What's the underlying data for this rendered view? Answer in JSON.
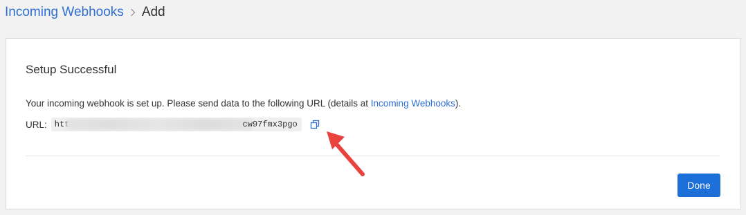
{
  "breadcrumb": {
    "parent": "Incoming Webhooks",
    "current": "Add"
  },
  "panel": {
    "title": "Setup Successful",
    "message_prefix": "Your incoming webhook is set up. Please send data to the following URL (details at ",
    "message_link": "Incoming Webhooks",
    "message_suffix": ").",
    "url_label": "URL:",
    "url_visible_start": "htt",
    "url_visible_end": "cw97fmx3pgo",
    "done_label": "Done"
  },
  "icons": {
    "separator": "chevron-right-icon",
    "copy": "copy-icon",
    "annotation": "red-arrow-annotation"
  },
  "colors": {
    "link": "#2f6fd3",
    "primary_button": "#1d6fd8",
    "annotation_arrow": "#e8433e"
  }
}
